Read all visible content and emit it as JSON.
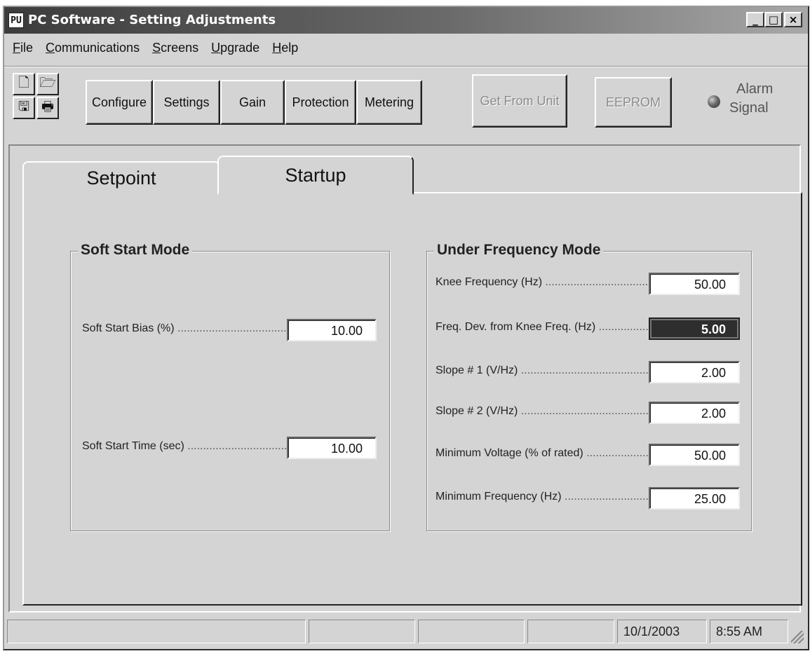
{
  "window": {
    "title": "PC Software - Setting Adjustments",
    "app_icon": "PU",
    "controls": {
      "minimize": "_",
      "maximize": "□",
      "close": "×"
    }
  },
  "menu": {
    "items": [
      {
        "label": "File"
      },
      {
        "label": "Communications"
      },
      {
        "label": "Screens"
      },
      {
        "label": "Upgrade"
      },
      {
        "label": "Help"
      }
    ]
  },
  "toolbar": {
    "icons": [
      {
        "name": "new-file-icon",
        "glyph": "🗋"
      },
      {
        "name": "open-folder-icon",
        "glyph": "🗁"
      },
      {
        "name": "save-icon",
        "glyph": "🖫"
      },
      {
        "name": "print-icon",
        "glyph": "🖶"
      }
    ],
    "buttons": [
      {
        "label": "Configure"
      },
      {
        "label": "Settings"
      },
      {
        "label": "Gain"
      },
      {
        "label": "Protection"
      },
      {
        "label": "Metering"
      }
    ],
    "get_from_unit": "Get From Unit",
    "eeprom": "EEPROM",
    "alarm_line1": "Alarm",
    "alarm_line2": "Signal"
  },
  "tabs": {
    "setpoint": "Setpoint",
    "startup": "Startup",
    "active": "Startup"
  },
  "soft_start": {
    "title": "Soft Start Mode",
    "bias_label": "Soft Start Bias (%)",
    "bias_value": "10.00",
    "time_label": "Soft Start Time (sec)",
    "time_value": "10.00"
  },
  "under_frequency": {
    "title": "Under Frequency Mode",
    "rows": [
      {
        "label": "Knee Frequency (Hz)",
        "value": "50.00"
      },
      {
        "label": "Freq. Dev. from Knee Freq. (Hz)",
        "value": "5.00"
      },
      {
        "label": "Slope # 1 (V/Hz)",
        "value": "2.00"
      },
      {
        "label": "Slope # 2 (V/Hz)",
        "value": "2.00"
      },
      {
        "label": "Minimum Voltage (% of rated)",
        "value": "50.00"
      },
      {
        "label": "Minimum Frequency (Hz)",
        "value": "25.00"
      }
    ]
  },
  "statusbar": {
    "date": "10/1/2003",
    "time": "8:55 AM"
  }
}
